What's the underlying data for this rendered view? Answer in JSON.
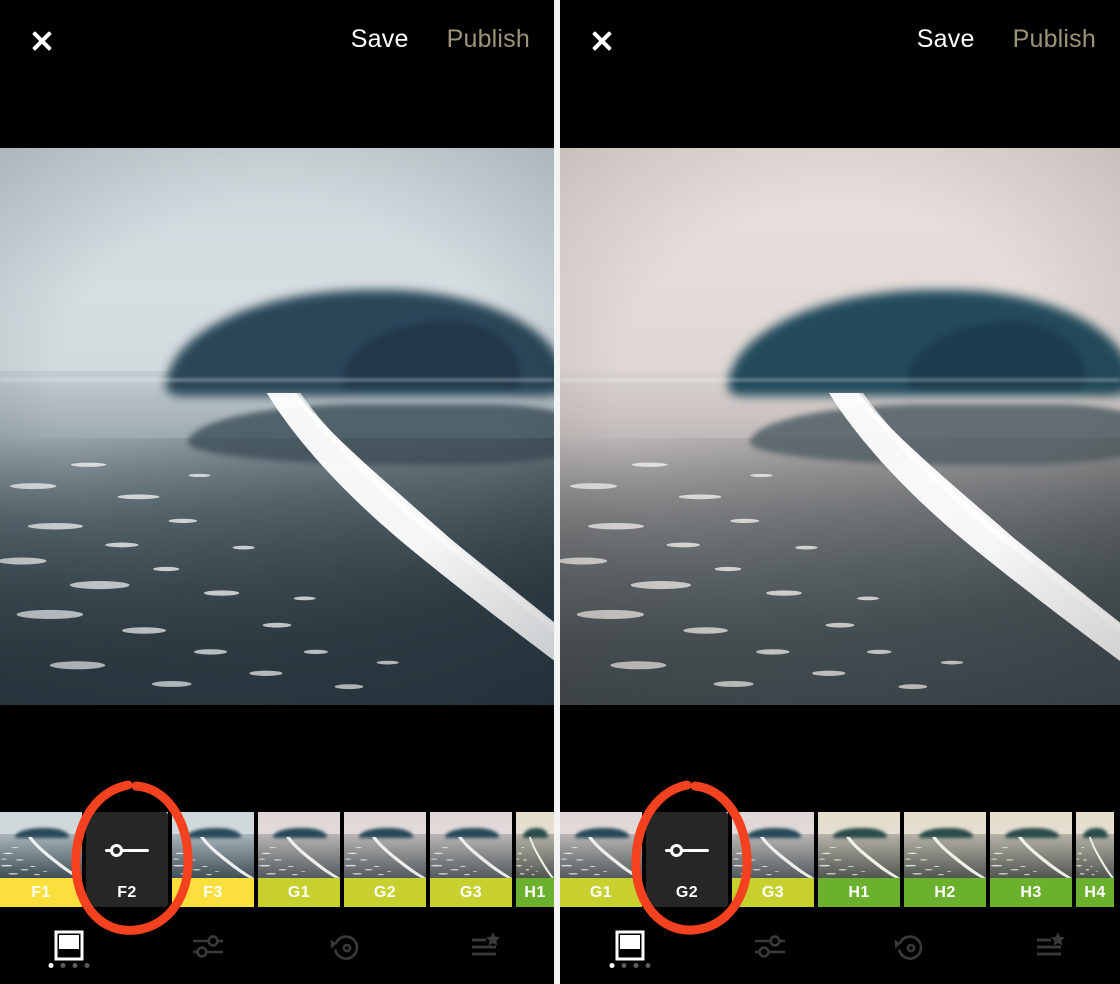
{
  "app": {
    "title": "Photo Filter Editor",
    "screens": 2
  },
  "colors": {
    "background": "#000000",
    "save_text": "#ffffff",
    "publish_text": "#9c9478",
    "selected_tile": "#262626",
    "label_f": "#fbdf3c",
    "label_g": "#c7d02e",
    "label_h": "#6cb12e",
    "annotation_red": "#f4411f",
    "active_icon": "#ffffff",
    "inactive_icon": "#3a3a3a",
    "divider": "#f3f3f3"
  },
  "panels": [
    {
      "id": "left-screen",
      "topbar": {
        "close_icon": "close-icon",
        "save_label": "Save",
        "publish_label": "Publish"
      },
      "photo": {
        "alt": "foggy beach with headland and foam line",
        "grade": "cool"
      },
      "filmstrip": {
        "presets": [
          {
            "name": "F1",
            "group": "F",
            "selected": false,
            "partial": false
          },
          {
            "name": "F2",
            "group": "F",
            "selected": true,
            "partial": false
          },
          {
            "name": "F3",
            "group": "F",
            "selected": false,
            "partial": false
          },
          {
            "name": "G1",
            "group": "G",
            "selected": false,
            "partial": false
          },
          {
            "name": "G2",
            "group": "G",
            "selected": false,
            "partial": false
          },
          {
            "name": "G3",
            "group": "G",
            "selected": false,
            "partial": false
          },
          {
            "name": "H1",
            "group": "H",
            "selected": false,
            "partial": true
          }
        ],
        "slider_value_percent": 30
      },
      "toolbar": {
        "tools": [
          {
            "icon": "preset-frame-icon",
            "name": "presets",
            "active": true
          },
          {
            "icon": "adjust-sliders-icon",
            "name": "adjust",
            "active": false
          },
          {
            "icon": "undo-revert-icon",
            "name": "revert",
            "active": false
          },
          {
            "icon": "recipes-star-icon",
            "name": "recipes",
            "active": false
          }
        ],
        "page_dots": {
          "count": 4,
          "active_index": 0
        }
      },
      "annotation": {
        "shape": "ellipse",
        "target_preset": "F2",
        "color": "#f4411f"
      }
    },
    {
      "id": "right-screen",
      "topbar": {
        "close_icon": "close-icon",
        "save_label": "Save",
        "publish_label": "Publish"
      },
      "photo": {
        "alt": "foggy beach with headland and foam line, warm tone",
        "grade": "warm"
      },
      "filmstrip": {
        "presets": [
          {
            "name": "G1",
            "group": "G",
            "selected": false,
            "partial": false
          },
          {
            "name": "G2",
            "group": "G",
            "selected": true,
            "partial": false
          },
          {
            "name": "G3",
            "group": "G",
            "selected": false,
            "partial": false
          },
          {
            "name": "H1",
            "group": "H",
            "selected": false,
            "partial": false
          },
          {
            "name": "H2",
            "group": "H",
            "selected": false,
            "partial": false
          },
          {
            "name": "H3",
            "group": "H",
            "selected": false,
            "partial": false
          },
          {
            "name": "H4",
            "group": "H",
            "selected": false,
            "partial": true
          }
        ],
        "slider_value_percent": 30
      },
      "toolbar": {
        "tools": [
          {
            "icon": "preset-frame-icon",
            "name": "presets",
            "active": true
          },
          {
            "icon": "adjust-sliders-icon",
            "name": "adjust",
            "active": false
          },
          {
            "icon": "undo-revert-icon",
            "name": "revert",
            "active": false
          },
          {
            "icon": "recipes-star-icon",
            "name": "recipes",
            "active": false
          }
        ],
        "page_dots": {
          "count": 4,
          "active_index": 0
        }
      },
      "annotation": {
        "shape": "ellipse",
        "target_preset": "G2",
        "color": "#f4411f"
      }
    }
  ]
}
